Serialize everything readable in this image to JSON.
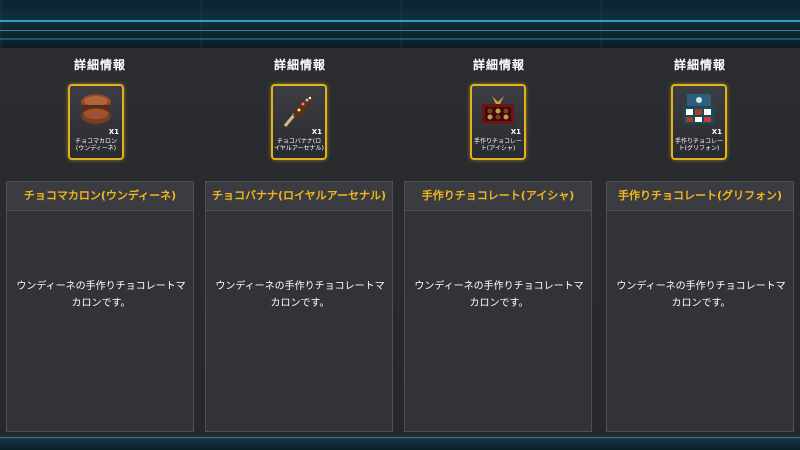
{
  "columns": [
    {
      "section_title": "詳細情報",
      "item": {
        "qty": "X1",
        "name": "チョコマカロン(ウンディーネ)",
        "icon": "macaron-icon"
      },
      "detail": {
        "title": "チョコマカロン(ウンディーネ)",
        "description": "ウンディーネの手作りチョコレートマカロンです。"
      }
    },
    {
      "section_title": "詳細情報",
      "item": {
        "qty": "X1",
        "name": "チョコバナナ(ロイヤルアーセナル)",
        "icon": "choco-banana-icon"
      },
      "detail": {
        "title": "チョコバナナ(ロイヤルアーセナル)",
        "description": "ウンディーネの手作りチョコレートマカロンです。"
      }
    },
    {
      "section_title": "詳細情報",
      "item": {
        "qty": "X1",
        "name": "手作りチョコレート(アイシャ)",
        "icon": "chocolate-box-icon"
      },
      "detail": {
        "title": "手作りチョコレート(アイシャ)",
        "description": "ウンディーネの手作りチョコレートマカロンです。"
      }
    },
    {
      "section_title": "詳細情報",
      "item": {
        "qty": "X1",
        "name": "手作りチョコレート(グリフォン)",
        "icon": "chocolate-tray-icon"
      },
      "detail": {
        "title": "手作りチョコレート(グリフォン)",
        "description": "ウンディーネの手作りチョコレートマカロンです。"
      }
    }
  ],
  "colors": {
    "title_gold": "#f3b51c",
    "card_border": "#e0b31e",
    "accent_cyan": "#2fb6d8"
  }
}
